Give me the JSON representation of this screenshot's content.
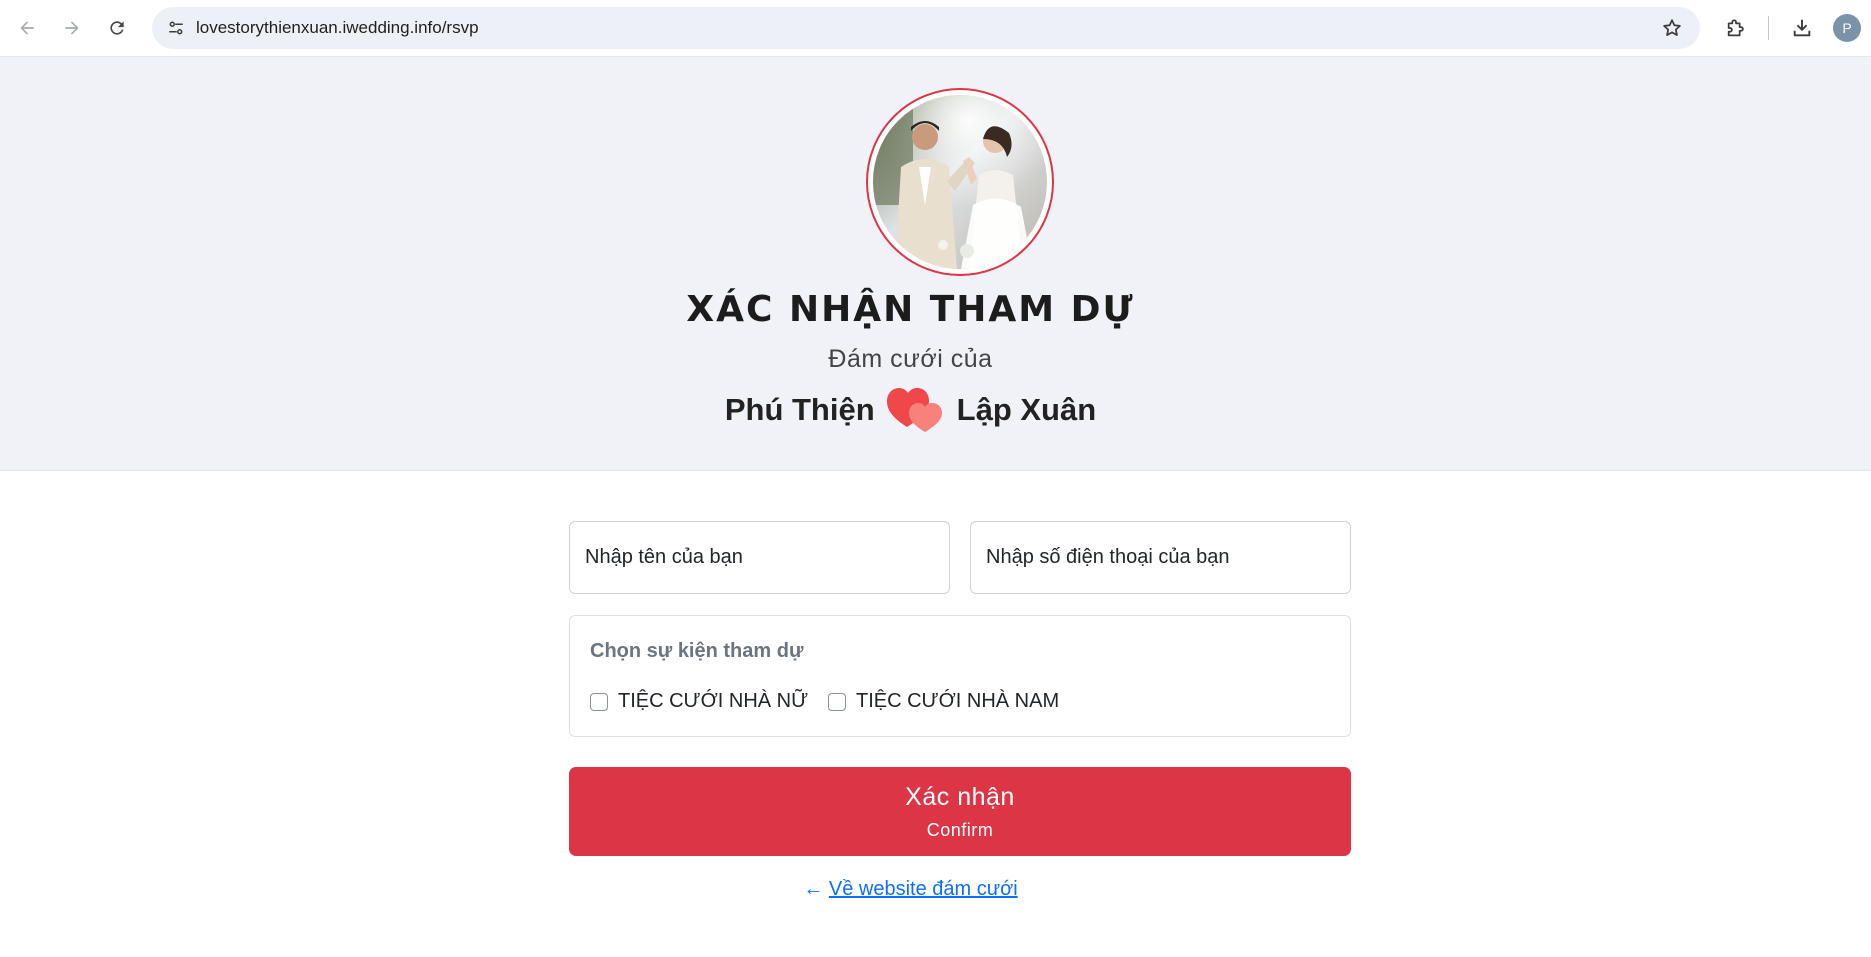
{
  "browser": {
    "url": "lovestorythienxuan.iwedding.info/rsvp",
    "profile_initial": "P",
    "icons": {
      "back": "back-arrow-icon",
      "forward": "forward-arrow-icon",
      "reload": "reload-icon",
      "site_info": "tune-icon",
      "bookmark": "star-icon",
      "extensions": "puzzle-icon",
      "downloads": "download-icon"
    }
  },
  "hero": {
    "title": "XÁC NHẬN THAM DỰ",
    "subtitle": "Đám cưới của",
    "groom": "Phú Thiện",
    "bride": "Lập Xuân",
    "heart_color": "#f4605b",
    "ring_color": "#dc3545"
  },
  "form": {
    "name_placeholder": "Nhập tên của bạn",
    "phone_placeholder": "Nhập số điện thoại của bạn",
    "events_label": "Chọn sự kiện tham dự",
    "events": [
      {
        "label": "TIỆC CƯỚI NHÀ NỮ",
        "checked": false
      },
      {
        "label": "TIỆC CƯỚI NHÀ NAM",
        "checked": false
      }
    ],
    "confirm_label": "Xác nhận",
    "confirm_sublabel": "Confirm",
    "confirm_color": "#dc3545",
    "back_arrow": "←",
    "back_link": "Về website đám cưới"
  }
}
